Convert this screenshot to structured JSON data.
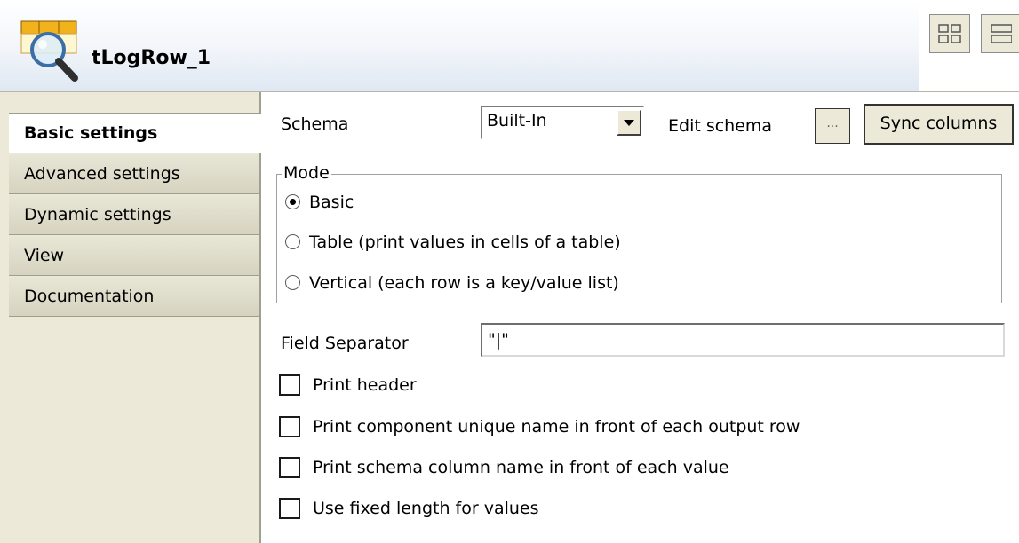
{
  "header": {
    "component_title": "tLogRow_1",
    "component_icon": "log-row-magnifier-icon"
  },
  "tabs": [
    {
      "label": "Basic settings",
      "active": true
    },
    {
      "label": "Advanced settings",
      "active": false
    },
    {
      "label": "Dynamic settings",
      "active": false
    },
    {
      "label": "View",
      "active": false
    },
    {
      "label": "Documentation",
      "active": false
    }
  ],
  "schema": {
    "label": "Schema",
    "value": "Built-In",
    "edit_label": "Edit schema",
    "dots_label": "...",
    "sync_label": "Sync columns"
  },
  "mode": {
    "legend": "Mode",
    "options": [
      {
        "label": "Basic",
        "selected": true
      },
      {
        "label": "Table (print values in cells of a table)",
        "selected": false
      },
      {
        "label": "Vertical (each row is a key/value list)",
        "selected": false
      }
    ]
  },
  "field_separator": {
    "label": "Field Separator",
    "value": "\"|\""
  },
  "checkboxes": [
    {
      "label": "Print header",
      "checked": false
    },
    {
      "label": "Print component unique name in front of each output row",
      "checked": false
    },
    {
      "label": "Print schema column name in front of each value",
      "checked": false
    },
    {
      "label": "Use fixed length for values",
      "checked": false
    }
  ],
  "colors": {
    "panel_bg": "#ece9d8",
    "header_gradient_end": "#dfe8f3"
  }
}
